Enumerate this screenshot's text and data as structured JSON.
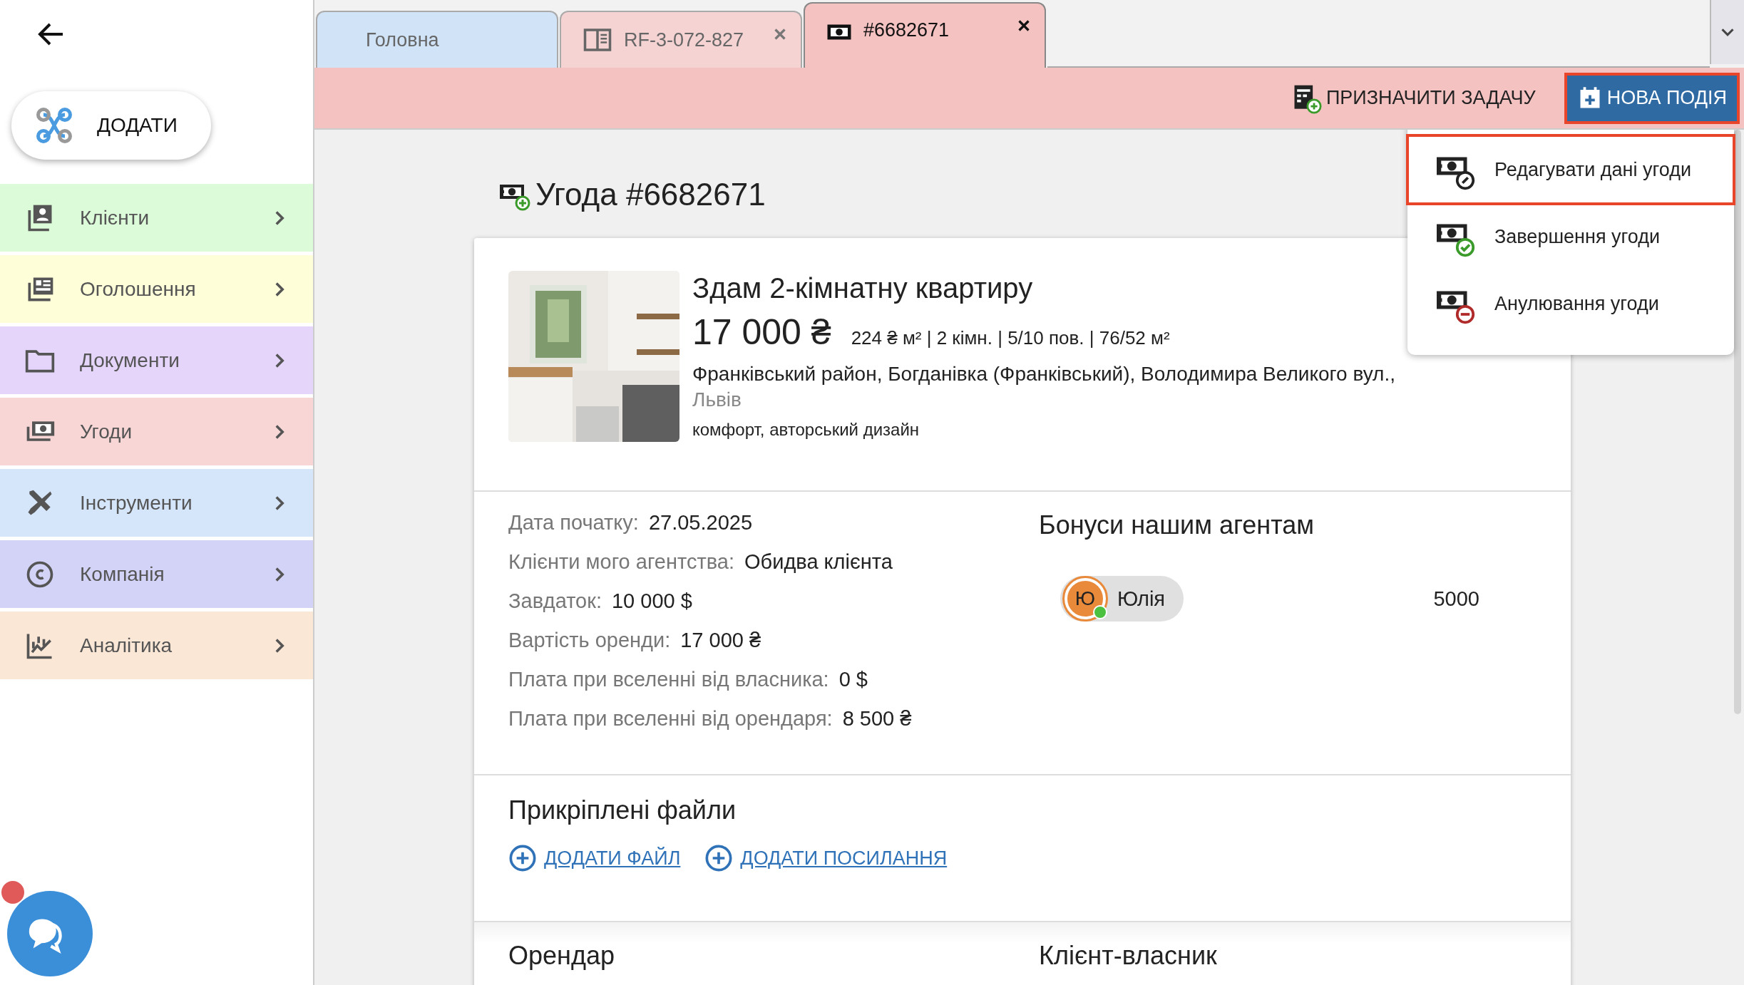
{
  "sidebar": {
    "add_button": {
      "label": "ДОДАТИ"
    },
    "items": [
      {
        "label": "Клієнти",
        "color": "#dcfbd9"
      },
      {
        "label": "Оголошення",
        "color": "#fefed8"
      },
      {
        "label": "Документи",
        "color": "#e5d5fb"
      },
      {
        "label": "Угоди",
        "color": "#f8d6d6"
      },
      {
        "label": "Інструменти",
        "color": "#d5e6fb"
      },
      {
        "label": "Компанія",
        "color": "#d3d3f8"
      },
      {
        "label": "Аналітика",
        "color": "#fbe7d6"
      }
    ],
    "chat": {
      "unread": true
    }
  },
  "tabs": [
    {
      "label": "Головна",
      "closable": false,
      "selected": false,
      "color": "#d0e3f7"
    },
    {
      "label": "RF-3-072-827",
      "closable": true,
      "selected": false,
      "color": "#f5d3d3"
    },
    {
      "label": "#6682671",
      "closable": true,
      "selected": true,
      "color": "#f5c2c2"
    }
  ],
  "toolbar": {
    "buttons": [
      {
        "label": "ПРИЗНАЧИТИ ЗАДАЧУ",
        "kind": "text",
        "highlighted": false
      },
      {
        "label": "НОВА ПОДІЯ",
        "kind": "filled",
        "highlighted": true
      }
    ]
  },
  "menu": {
    "items": [
      {
        "label": "Редагувати дані угоди",
        "highlighted": true
      },
      {
        "label": "Завершення угоди",
        "highlighted": false
      },
      {
        "label": "Анулювання угоди",
        "highlighted": false
      }
    ]
  },
  "deal": {
    "title": "Угода #6682671",
    "listing": {
      "title": "Здам 2-кімнатну квартиру",
      "price": "17 000 ₴",
      "specs": "224 ₴ м² | 2 кімн. | 5/10 пов. | 76/52 м²",
      "address": "Франківський район, Богданівка (Франківський), Володимира Великого вул.,",
      "city": "Львів",
      "tags": "комфорт, авторський дизайн"
    },
    "details": [
      {
        "label": "Дата початку:",
        "value": "27.05.2025"
      },
      {
        "label": "Клієнти мого агентства:",
        "value": "Обидва клієнта"
      },
      {
        "label": "Завдаток:",
        "value": "10 000 $"
      },
      {
        "label": "Вартість оренди:",
        "value": "17 000 ₴"
      },
      {
        "label": "Плата при вселенні від власника:",
        "value": "0 $"
      },
      {
        "label": "Плата при вселенні від орендаря:",
        "value": "8 500 ₴"
      }
    ],
    "bonuses": {
      "title": "Бонуси нашим агентам",
      "agents": [
        {
          "initial": "Ю",
          "name": "Юлія",
          "online": true,
          "amount": "5000"
        }
      ]
    },
    "files": {
      "title": "Прикріплені файли",
      "links": [
        "ДОДАТИ ФАЙЛ",
        "ДОДАТИ ПОСИЛАННЯ"
      ]
    },
    "parties": [
      "Орендар",
      "Клієнт-власник"
    ]
  }
}
